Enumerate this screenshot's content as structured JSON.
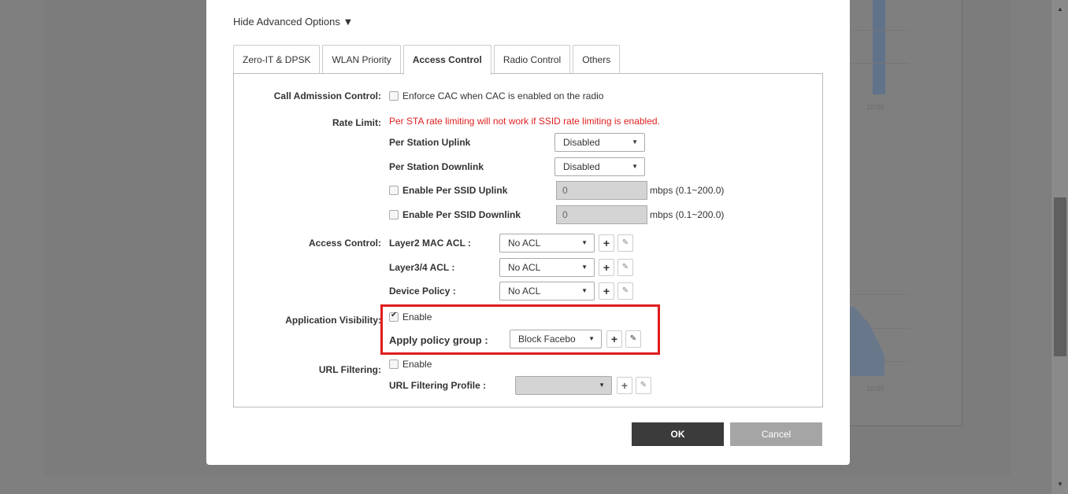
{
  "background_chart": {
    "tick_label_top": "10:00",
    "tick_label_bottom": "10:00",
    "bar_color": "#a4b8d2"
  },
  "modal": {
    "advanced_toggle": "Hide Advanced Options ▼",
    "tabs": [
      {
        "label": "Zero-IT & DPSK",
        "active": false
      },
      {
        "label": "WLAN Priority",
        "active": false
      },
      {
        "label": "Access Control",
        "active": true
      },
      {
        "label": "Radio Control",
        "active": false
      },
      {
        "label": "Others",
        "active": false
      }
    ],
    "call_admission": {
      "label": "Call Admission Control:",
      "checkbox_label": "Enforce CAC when CAC is enabled on the radio",
      "checked": false
    },
    "rate_limit": {
      "label": "Rate Limit:",
      "warning": "Per STA rate limiting will not work if SSID rate limiting is enabled.",
      "uplink_label": "Per Station Uplink",
      "uplink_value": "Disabled",
      "downlink_label": "Per Station Downlink",
      "downlink_value": "Disabled",
      "ssid_uplink_label": "Enable Per SSID Uplink",
      "ssid_uplink_value": "0",
      "ssid_uplink_unit": "mbps (0.1~200.0)",
      "ssid_downlink_label": "Enable Per SSID Downlink",
      "ssid_downlink_value": "0",
      "ssid_downlink_unit": "mbps (0.1~200.0)"
    },
    "access_control": {
      "label": "Access Control:",
      "l2_label": "Layer2 MAC ACL :",
      "l2_value": "No ACL",
      "l34_label": "Layer3/4 ACL :",
      "l34_value": "No ACL",
      "device_label": "Device Policy :",
      "device_value": "No ACL"
    },
    "app_visibility": {
      "label": "Application Visibility:",
      "enable_label": "Enable",
      "enabled": true,
      "policy_label": "Apply policy group :",
      "policy_value": "Block Facebo"
    },
    "url_filtering": {
      "label": "URL Filtering:",
      "enable_label": "Enable",
      "enabled": false,
      "profile_label": "URL Filtering Profile :",
      "profile_value": ""
    },
    "ok_label": "OK",
    "cancel_label": "Cancel"
  },
  "icons": {
    "add": "+",
    "edit": "✎",
    "caret": "▼",
    "scroll_up": "▲",
    "scroll_down": "▼"
  },
  "colors": {
    "warning": "#e02020",
    "highlight": "#e01c1c",
    "ok_button": "#3b3b3b",
    "cancel_button": "#a5a5a5"
  }
}
